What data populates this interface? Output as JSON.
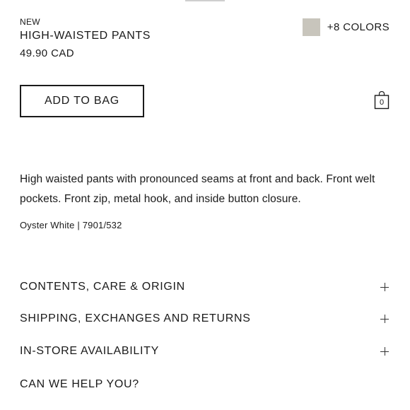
{
  "product": {
    "badge": "NEW",
    "name": "HIGH-WAISTED PANTS",
    "price": "49.90 CAD",
    "colors": {
      "swatch_color": "#c8c5bc",
      "more_label": "+8 COLORS"
    },
    "description": "High waisted pants with pronounced seams at front and back. Front welt pockets. Front zip, metal hook, and inside button closure.",
    "color_reference": "Oyster White | 7901/532"
  },
  "actions": {
    "add_to_bag_label": "ADD TO BAG",
    "bag_icon": "shopping-bag-icon",
    "bag_count": "0"
  },
  "accordion": {
    "items": [
      {
        "label": "CONTENTS, CARE & ORIGIN",
        "icon": "plus-icon"
      },
      {
        "label": "SHIPPING, EXCHANGES AND RETURNS",
        "icon": "plus-icon"
      },
      {
        "label": "IN-STORE AVAILABILITY",
        "icon": "plus-icon"
      }
    ]
  },
  "help": {
    "label": "CAN WE HELP YOU?"
  }
}
